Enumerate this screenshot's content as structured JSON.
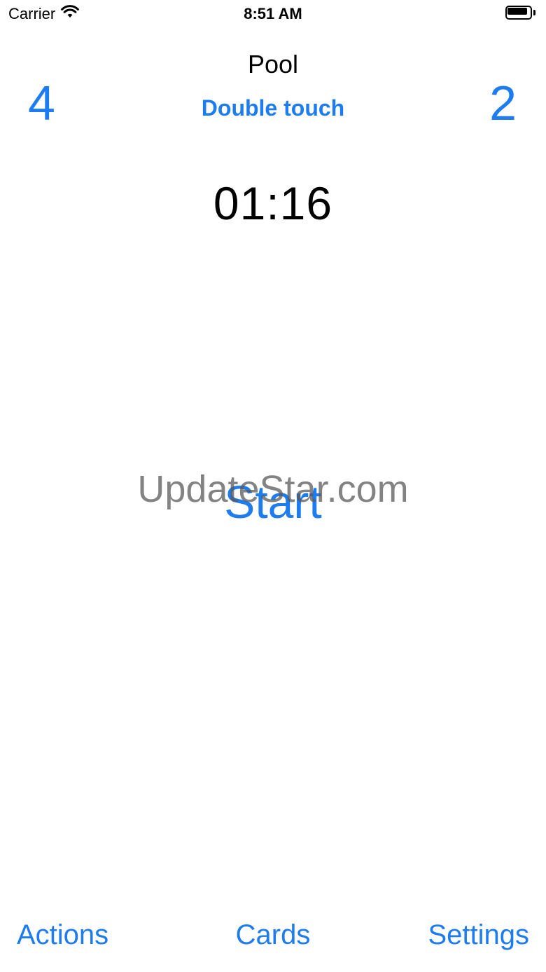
{
  "status_bar": {
    "carrier": "Carrier",
    "time": "8:51 AM",
    "icons": [
      "wifi-icon",
      "battery-icon"
    ]
  },
  "header": {
    "title": "Pool",
    "left_score": "4",
    "right_score": "2",
    "mode": "Double touch"
  },
  "timer": {
    "value": "01:16"
  },
  "main": {
    "start_label": "Start",
    "watermark": "UpdateStar.com"
  },
  "tab_bar": {
    "actions_label": "Actions",
    "cards_label": "Cards",
    "settings_label": "Settings"
  },
  "colors": {
    "accent": "#1c7cf0",
    "text": "#000000",
    "background": "#ffffff"
  }
}
